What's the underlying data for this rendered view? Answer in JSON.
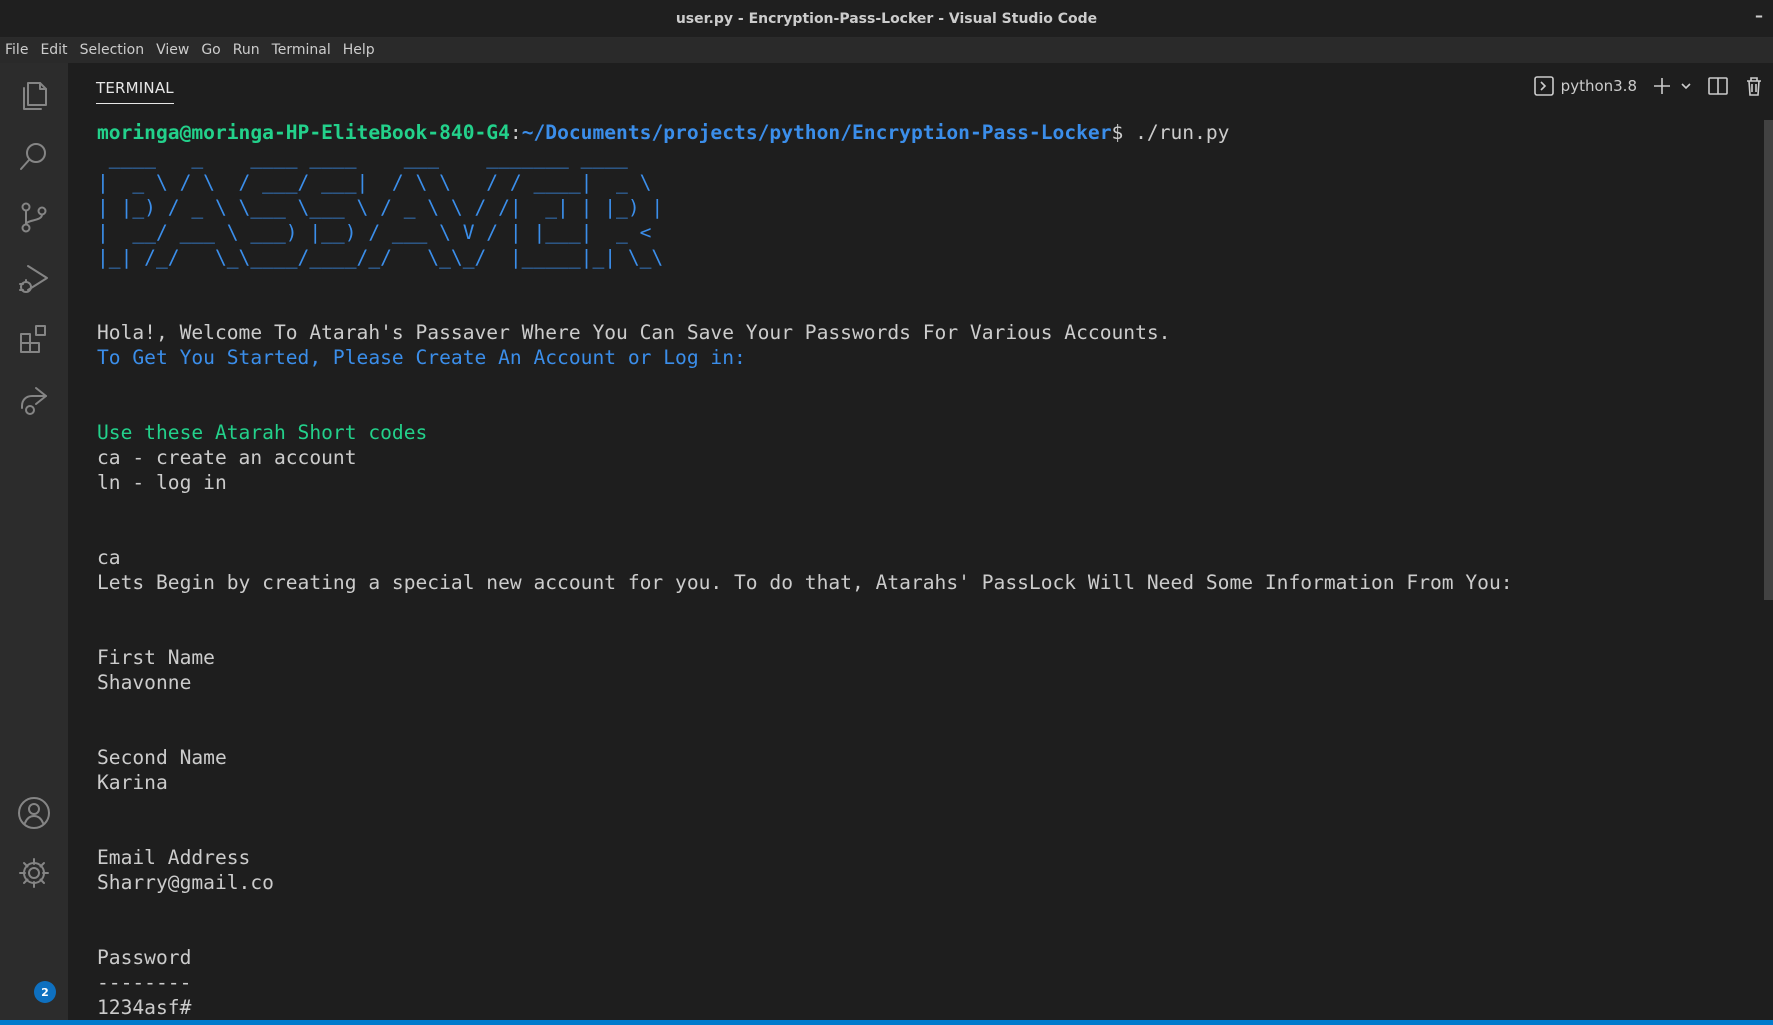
{
  "window": {
    "title": "user.py - Encryption-Pass-Locker - Visual Studio Code",
    "minimize": "–"
  },
  "menu": [
    "File",
    "Edit",
    "Selection",
    "View",
    "Go",
    "Run",
    "Terminal",
    "Help"
  ],
  "activity_bar": {
    "icons": [
      "explorer-icon",
      "search-icon",
      "source-control-icon",
      "run-debug-icon",
      "extensions-icon",
      "remote-icon"
    ],
    "bottom_icons": [
      "account-icon",
      "gear-icon"
    ],
    "account_badge": "2"
  },
  "panel": {
    "tab": "TERMINAL",
    "shell": "python3.8"
  },
  "terminal": {
    "prompt_user": "moringa@moringa-HP-EliteBook-840-G4",
    "prompt_sep": ":",
    "prompt_path": "~/Documents/projects/python/Encryption-Pass-Locker",
    "prompt_cmd": "$ ./run.py",
    "banner": [
      " ____   _    ____ ____    ___    _______ ____  ",
      "|  _ \\ / \\  / ___/ ___|  / \\ \\   / / ____|  _ \\ ",
      "| |_) / _ \\ \\___ \\___ \\ / _ \\ \\ / /|  _| | |_) |",
      "|  __/ ___ \\ ___) |__) / ___ \\ V / | |___|  _ < ",
      "|_| /_/   \\_\\____/____/_/   \\_\\_/  |_____|_| \\_\\"
    ],
    "welcome": "Hola!, Welcome To Atarah's Passaver Where You Can Save Your Passwords For Various Accounts.",
    "get_started": "To Get You Started, Please Create An Account or Log in:",
    "shortcodes_title": "Use these Atarah Short codes",
    "shortcode_ca": "ca - create an account",
    "shortcode_ln": "ln - log in",
    "input_ca": "ca",
    "begin": "Lets Begin by creating a special new account for you. To do that, Atarahs' PassLock Will Need Some Information From You:",
    "first_name_label": "First Name",
    "first_name_value": "Shavonne",
    "second_name_label": "Second Name",
    "second_name_value": "Karina",
    "email_label": "Email Address",
    "email_value": "Sharry@gmail.co",
    "password_label": "Password",
    "password_rule": "--------",
    "password_value": "1234asf#"
  },
  "colors": {
    "prompt_user": "#23d18b",
    "prompt_path": "#3b8eea",
    "banner": "#3b8eea",
    "accent": "#007acc"
  }
}
